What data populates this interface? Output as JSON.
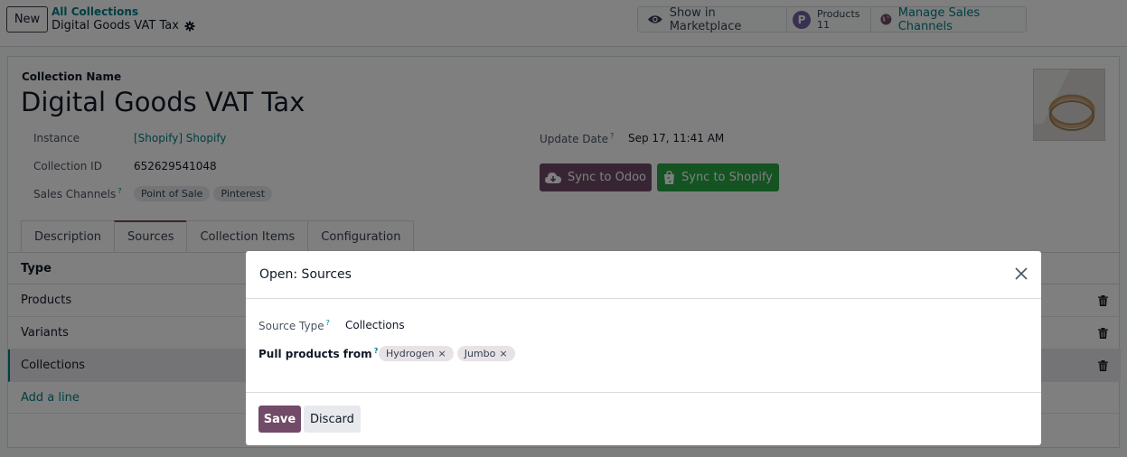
{
  "control_panel": {
    "new_label": "New",
    "breadcrumb_parent": "All Collections",
    "breadcrumb_current": "Digital Goods VAT Tax",
    "smart_buttons": {
      "marketplace_label": "Show in Marketplace",
      "products_label": "Products",
      "products_count": "11",
      "channels_label": "Manage Sales Channels"
    }
  },
  "form": {
    "name_label": "Collection Name",
    "name": "Digital Goods VAT Tax",
    "fields": {
      "instance_label": "Instance",
      "instance_value": "[Shopify] Shopify",
      "collection_id_label": "Collection ID",
      "collection_id_value": "652629541048",
      "sales_channels_label": "Sales Channels",
      "sales_channels": [
        "Point of Sale",
        "Pinterest"
      ],
      "update_date_label": "Update Date",
      "update_date_value": "Sep 17, 11:41 AM"
    },
    "help_mark": "?",
    "buttons": {
      "sync_odoo": "Sync to Odoo",
      "sync_shopify": "Sync to Shopify"
    },
    "tabs": [
      "Description",
      "Sources",
      "Collection Items",
      "Configuration"
    ],
    "active_tab": "Sources",
    "list": {
      "header": "Type",
      "rows": [
        "Products",
        "Variants",
        "Collections"
      ],
      "selected_row": "Collections",
      "add_line": "Add a line"
    }
  },
  "modal": {
    "title": "Open: Sources",
    "source_type_label": "Source Type",
    "source_type_value": "Collections",
    "pull_from_label": "Pull products from",
    "pull_from_tags": [
      "Hydrogen",
      "Jumbo"
    ],
    "tag_remove_glyph": "×",
    "save_label": "Save",
    "discard_label": "Discard"
  },
  "colors": {
    "primary": "#714b67",
    "link": "#017e84",
    "success": "#28a745",
    "badge": "#71639e"
  },
  "icons": [
    "gear-icon",
    "eye-icon",
    "globe-icon",
    "cloud-download-icon",
    "shopify-bag-icon",
    "trash-icon",
    "close-icon"
  ]
}
